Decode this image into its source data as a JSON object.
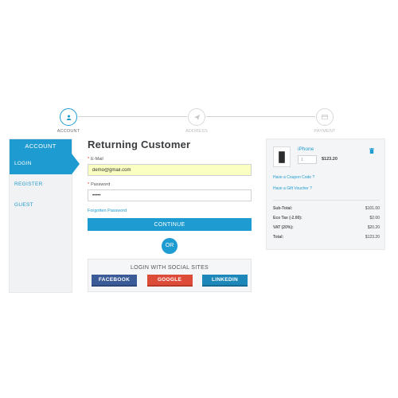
{
  "steps": [
    {
      "label": "ACCOUNT",
      "icon": "user-icon",
      "active": true
    },
    {
      "label": "ADDRESS",
      "icon": "paper-plane-icon",
      "active": false
    },
    {
      "label": "PAYMENT",
      "icon": "credit-card-icon",
      "active": false
    }
  ],
  "sidebar": {
    "header": "ACCOUNT",
    "items": [
      {
        "label": "LOGIN"
      },
      {
        "label": "REGISTER"
      },
      {
        "label": "GUEST"
      }
    ]
  },
  "form": {
    "title": "Returning Customer",
    "email_label": "E-Mail",
    "email_value": "demo@gmail.com",
    "password_label": "Password",
    "password_value": "•••••",
    "forgot_link": "Forgotten Password",
    "continue_label": "CONTINUE",
    "or_label": "OR"
  },
  "social": {
    "title": "LOGIN WITH SOCIAL SITES",
    "facebook": "FACEBOOK",
    "google": "GOOGLE",
    "linkedin": "LINKEDIN"
  },
  "cart": {
    "product_name": "iPhone",
    "qty": "1",
    "price": "$123.20",
    "coupon_link": "Have a Coupon Code ?",
    "voucher_link": "Have a Gift Voucher ?",
    "totals": [
      {
        "label": "Sub-Total:",
        "value": "$101.00"
      },
      {
        "label": "Eco Tax (-2.00):",
        "value": "$2.00"
      },
      {
        "label": "VAT (20%):",
        "value": "$20.20"
      },
      {
        "label": "Total:",
        "value": "$123.20"
      }
    ]
  },
  "colors": {
    "accent": "#1e9bd0",
    "facebook": "#3b5b98",
    "google": "#dd4b39",
    "linkedin": "#1c87b8",
    "autofill": "#fbffc2"
  }
}
